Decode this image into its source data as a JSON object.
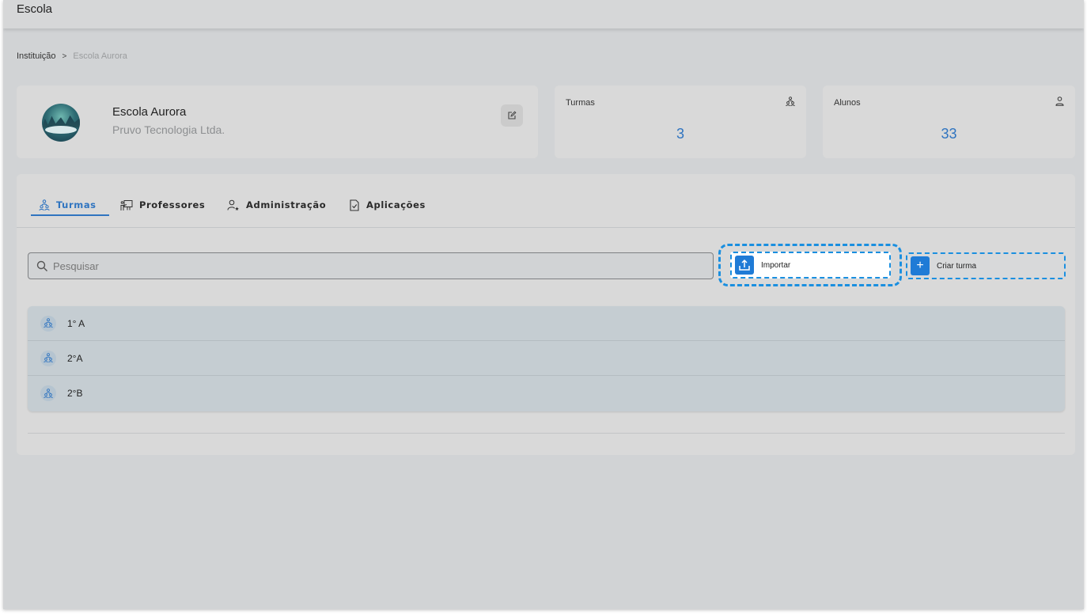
{
  "app": {
    "title": "Escola"
  },
  "breadcrumb": {
    "root": "Instituição",
    "separator": ">",
    "current": "Escola Aurora"
  },
  "school": {
    "name": "Escola Aurora",
    "company": "Pruvo Tecnologia Ltda."
  },
  "stats": {
    "classes": {
      "label": "Turmas",
      "value": "3",
      "icon": "classes-icon"
    },
    "students": {
      "label": "Alunos",
      "value": "33",
      "icon": "person-icon"
    }
  },
  "tabs": [
    {
      "label": "Turmas",
      "icon": "classes-icon",
      "active": true
    },
    {
      "label": "Professores",
      "icon": "teacher-board-icon",
      "active": false
    },
    {
      "label": "Administração",
      "icon": "admin-user-icon",
      "active": false
    },
    {
      "label": "Aplicações",
      "icon": "document-check-icon",
      "active": false
    }
  ],
  "search": {
    "placeholder": "Pesquisar"
  },
  "actions": {
    "import_label": "Importar",
    "create_label": "Criar turma"
  },
  "classes": [
    {
      "label": "1° A"
    },
    {
      "label": "2°A"
    },
    {
      "label": "2°B"
    }
  ],
  "colors": {
    "accent": "#2f74c0",
    "focus": "#1a8fe0",
    "background": "#d1d3d5"
  }
}
